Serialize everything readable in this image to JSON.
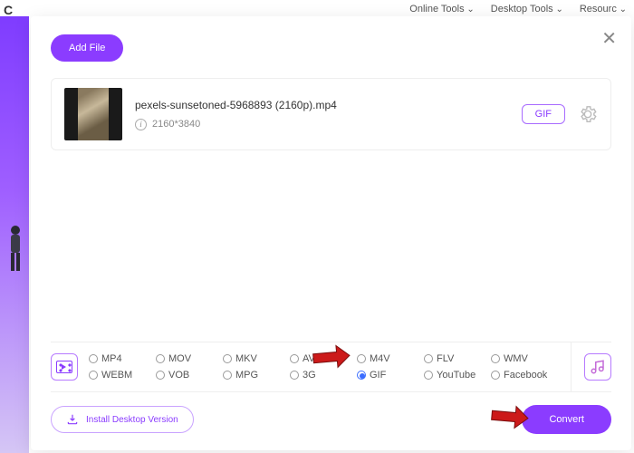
{
  "nav": {
    "online_tools": "Online Tools",
    "desktop_tools": "Desktop Tools",
    "resources": "Resourc"
  },
  "logo": "C",
  "buttons": {
    "add_file": "Add File",
    "install": "Install Desktop Version",
    "convert": "Convert"
  },
  "file": {
    "name": "pexels-sunsetoned-5968893 (2160p).mp4",
    "resolution": "2160*3840",
    "target_format": "GIF"
  },
  "formats": {
    "row1": [
      "MP4",
      "MOV",
      "MKV",
      "AVI",
      "M4V",
      "FLV",
      "WMV"
    ],
    "row2": [
      "WEBM",
      "VOB",
      "MPG",
      "3G",
      "GIF",
      "YouTube",
      "Facebook"
    ],
    "selected": "GIF"
  }
}
